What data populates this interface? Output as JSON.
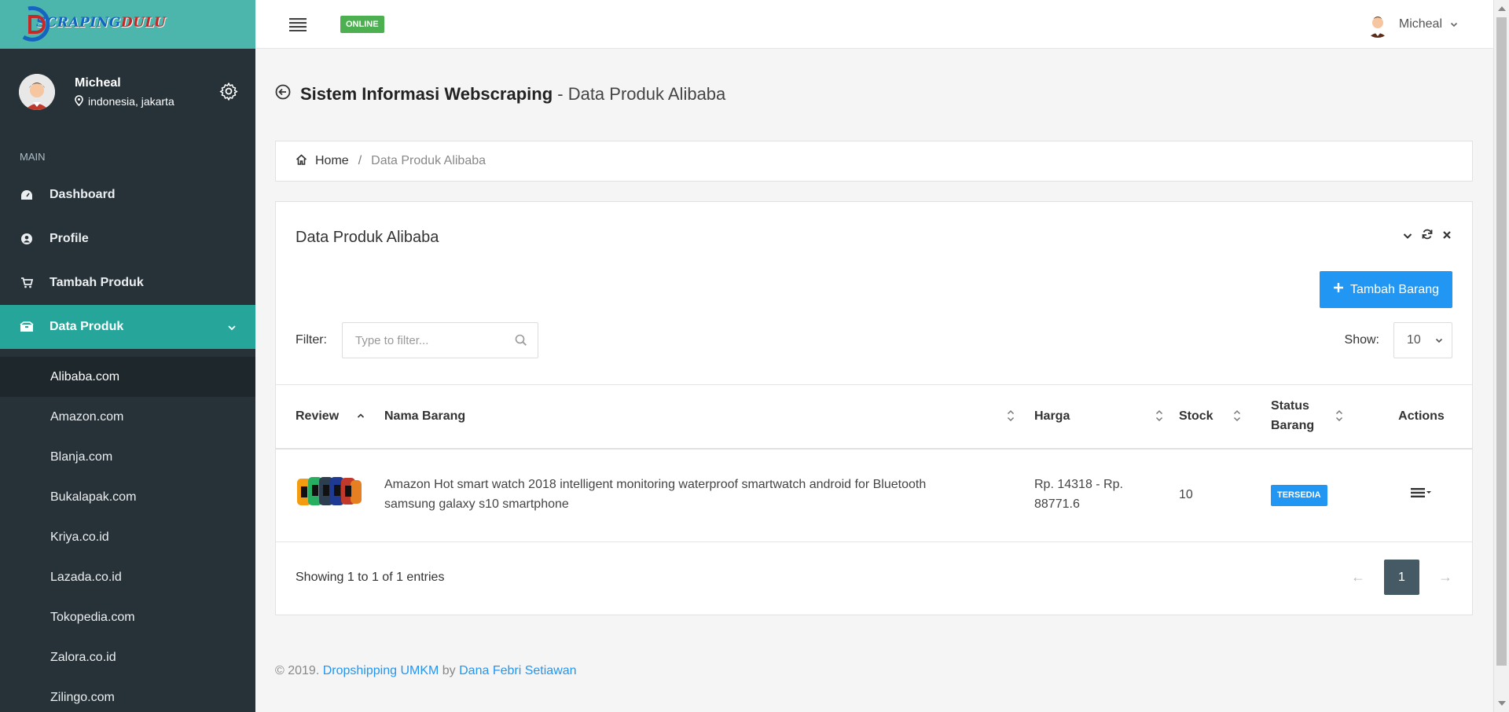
{
  "brand": {
    "part1": "SCRAPING",
    "part2": "DULU"
  },
  "sidebar": {
    "user": {
      "name": "Micheal",
      "location": "indonesia, jakarta"
    },
    "section_label": "MAIN",
    "items": [
      {
        "label": "Dashboard",
        "icon": "dashboard-icon"
      },
      {
        "label": "Profile",
        "icon": "user-circle-icon"
      },
      {
        "label": "Tambah Produk",
        "icon": "cart-icon"
      },
      {
        "label": "Data Produk",
        "icon": "boxes-icon"
      }
    ],
    "submenu": [
      "Alibaba.com",
      "Amazon.com",
      "Blanja.com",
      "Bukalapak.com",
      "Kriya.co.id",
      "Lazada.co.id",
      "Tokopedia.com",
      "Zalora.co.id",
      "Zilingo.com"
    ]
  },
  "topbar": {
    "status": "ONLINE",
    "user_name": "Micheal"
  },
  "page": {
    "title_strong": "Sistem Informasi Webscraping",
    "title_rest": " - Data Produk Alibaba"
  },
  "breadcrumb": {
    "home": "Home",
    "current": "Data Produk Alibaba"
  },
  "panel": {
    "title": "Data Produk Alibaba",
    "add_button": "Tambah Barang",
    "filter_label": "Filter:",
    "filter_placeholder": "Type to filter...",
    "show_label": "Show:",
    "show_value": "10"
  },
  "table": {
    "headers": {
      "review": "Review",
      "name": "Nama Barang",
      "price": "Harga",
      "stock": "Stock",
      "status_line1": "Status",
      "status_line2": "Barang",
      "actions": "Actions"
    },
    "rows": [
      {
        "name": "Amazon Hot smart watch 2018 intelligent monitoring waterproof smartwatch android for Bluetooth samsung galaxy s10 smartphone",
        "price_line1": "Rp. 14318 - Rp.",
        "price_line2": "88771.6",
        "stock": "10",
        "status": "TERSEDIA"
      }
    ]
  },
  "pagination": {
    "info": "Showing 1 to 1 of 1 entries",
    "prev": "←",
    "current": "1",
    "next": "→"
  },
  "footer": {
    "copyright": "© 2019. ",
    "link1": "Dropshipping UMKM",
    "by": " by ",
    "link2": "Dana Febri Setiawan"
  },
  "colors": {
    "sidebar_bg": "#263238",
    "accent": "#26a69a",
    "brand_bg": "#4db6ac",
    "primary": "#2196f3",
    "online": "#4caf50"
  }
}
